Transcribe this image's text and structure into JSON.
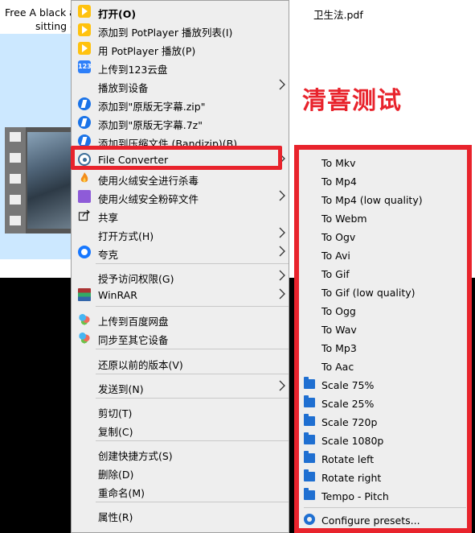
{
  "background": {
    "file_left_line1": "Free A black a",
    "file_left_line2": "sitting c",
    "file_right": "卫生法.pdf",
    "overlay_title": "清喜测试"
  },
  "context_menu": {
    "items": [
      {
        "label": "打开(O)",
        "icon": "potplayer-icon"
      },
      {
        "label": "添加到 PotPlayer 播放列表(I)",
        "icon": "potplayer-icon"
      },
      {
        "label": "用 PotPlayer 播放(P)",
        "icon": "potplayer-icon"
      },
      {
        "label": "上传到123云盘",
        "icon": "cloud-123-icon"
      },
      {
        "label": "播放到设备",
        "icon": "",
        "submenu": true
      },
      {
        "label": "添加到\"原版无字幕.zip\"",
        "icon": "bandizip-icon"
      },
      {
        "label": "添加到\"原版无字幕.7z\"",
        "icon": "bandizip-icon"
      },
      {
        "label": "添加到压缩文件 (Bandizip)(B)...",
        "icon": "bandizip-icon"
      },
      {
        "label": "File Converter",
        "icon": "file-converter-icon",
        "submenu": true
      },
      {
        "label": "使用火绒安全进行杀毒",
        "icon": "huorong-icon"
      },
      {
        "label": "使用火绒安全粉碎文件",
        "icon": "huorong-shred-icon",
        "submenu": true
      },
      {
        "label": "共享",
        "icon": "share-icon"
      },
      {
        "label": "打开方式(H)",
        "icon": "",
        "submenu": true
      },
      {
        "label": "夸克",
        "icon": "quark-icon",
        "submenu": true
      },
      {
        "label": "授予访问权限(G)",
        "icon": "",
        "submenu": true
      },
      {
        "label": "WinRAR",
        "icon": "winrar-icon",
        "submenu": true
      },
      {
        "label": "上传到百度网盘",
        "icon": "baidu-cloud-icon"
      },
      {
        "label": "同步至其它设备",
        "icon": "baidu-cloud-icon"
      },
      {
        "label": "还原以前的版本(V)",
        "icon": ""
      },
      {
        "label": "发送到(N)",
        "icon": "",
        "submenu": true
      },
      {
        "label": "剪切(T)",
        "icon": ""
      },
      {
        "label": "复制(C)",
        "icon": ""
      },
      {
        "label": "创建快捷方式(S)",
        "icon": ""
      },
      {
        "label": "删除(D)",
        "icon": ""
      },
      {
        "label": "重命名(M)",
        "icon": ""
      },
      {
        "label": "属性(R)",
        "icon": ""
      }
    ]
  },
  "file_converter_submenu": {
    "items": [
      {
        "label": "To Mkv"
      },
      {
        "label": "To Mp4"
      },
      {
        "label": "To Mp4 (low quality)"
      },
      {
        "label": "To Webm"
      },
      {
        "label": "To Ogv"
      },
      {
        "label": "To Avi"
      },
      {
        "label": "To Gif"
      },
      {
        "label": "To Gif (low quality)"
      },
      {
        "label": "To Ogg"
      },
      {
        "label": "To Wav"
      },
      {
        "label": "To Mp3"
      },
      {
        "label": "To Aac"
      },
      {
        "label": "Scale 75%",
        "icon": "folder-icon"
      },
      {
        "label": "Scale 25%",
        "icon": "folder-icon"
      },
      {
        "label": "Scale 720p",
        "icon": "folder-icon"
      },
      {
        "label": "Scale 1080p",
        "icon": "folder-icon"
      },
      {
        "label": "Rotate left",
        "icon": "folder-icon"
      },
      {
        "label": "Rotate right",
        "icon": "folder-icon"
      },
      {
        "label": "Tempo - Pitch",
        "icon": "folder-icon"
      },
      {
        "label": "Configure presets...",
        "icon": "gear-icon"
      }
    ]
  },
  "colors": {
    "highlight": "#e8232c",
    "menu_bg": "#eeeeee"
  }
}
